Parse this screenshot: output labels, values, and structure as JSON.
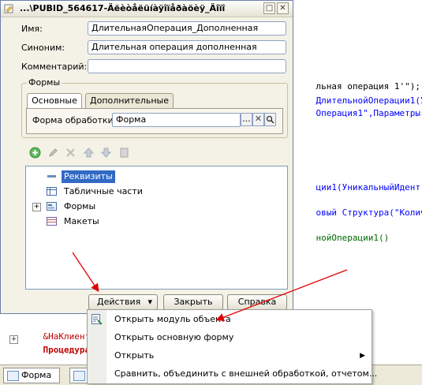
{
  "editor": {
    "lines": [
      {
        "parts": [
          {
            "t": "льная операция 1'\");",
            "c": "str"
          }
        ]
      },
      {
        "parts": [
          {
            "t": "ДлительнойОперации1(У",
            "c": "fn"
          }
        ]
      },
      {
        "parts": [
          {
            "t": "Операция1\",Параметры",
            "c": "fn"
          }
        ]
      },
      {
        "parts": [
          {
            "t": "ции1(УникальныйИдент",
            "c": "fn"
          }
        ]
      },
      {
        "parts": [
          {
            "t": "овый Структура(\"Колич",
            "c": "fn"
          }
        ]
      },
      {
        "parts": [
          {
            "t": "нойОперации1()",
            "c": "grn"
          }
        ]
      }
    ],
    "bottom_lines": [
      {
        "t": "&НаКлиенте",
        "c": "kw"
      },
      {
        "t": "Процедура",
        "c": "kw"
      }
    ],
    "gutter_marks": [
      "+",
      "-",
      "-",
      "-",
      "+"
    ]
  },
  "tabbar": {
    "tabs": [
      {
        "label": "Форма"
      },
      {
        "label": "М"
      }
    ]
  },
  "dialog": {
    "title": "...\\PUBID_564617-Äëèòåëüíàÿîïåðàöèÿ_Äîïî",
    "window_buttons": {
      "maximize": "□",
      "close": "✕"
    },
    "fields": {
      "name_label": "Имя:",
      "name_value": "ДлительнаяОперация_Дополненная",
      "synonym_label": "Синоним:",
      "synonym_value": "Длительная операция дополненная",
      "comment_label": "Комментарий:",
      "comment_value": ""
    },
    "forms_group": {
      "legend": "Формы",
      "tabs": [
        {
          "label": "Основные"
        },
        {
          "label": "Дополнительные"
        }
      ],
      "processing_form_label": "Форма обработки:",
      "processing_form_value": "Форма",
      "select_button": "...",
      "clear_button": "✕",
      "open_button": "🔍"
    },
    "tree": {
      "items": [
        {
          "label": "Реквизиты",
          "icon": "attributes-icon",
          "selected": true
        },
        {
          "label": "Табличные части",
          "icon": "table-icon",
          "selected": false
        },
        {
          "label": "Формы",
          "icon": "form-icon",
          "selected": false,
          "expandable": "+"
        },
        {
          "label": "Макеты",
          "icon": "template-icon",
          "selected": false
        }
      ]
    },
    "buttons": {
      "actions": "Действия",
      "actions_arrow": "▾",
      "close": "Закрыть",
      "help": "Справка"
    }
  },
  "menu": {
    "items": [
      {
        "label": "Открыть модуль объекта",
        "has_submenu": false
      },
      {
        "label": "Открыть основную форму",
        "has_submenu": false
      },
      {
        "label": "Открыть",
        "has_submenu": true,
        "arrow": "▶"
      },
      {
        "label": "Сравнить, объединить с внешней обработкой, отчетом...",
        "has_submenu": false
      }
    ]
  },
  "colors": {
    "annotation_arrow": "#e00000",
    "selection": "#316ac5"
  }
}
